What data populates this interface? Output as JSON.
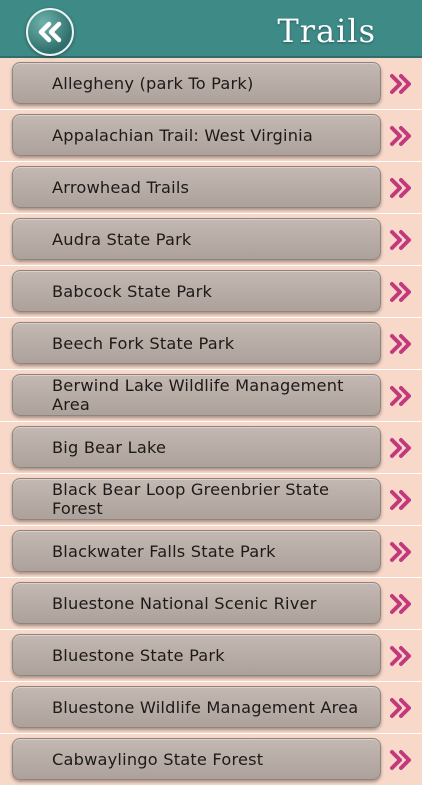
{
  "header": {
    "title": "Trails",
    "back_icon": "double-chevron-left-icon"
  },
  "colors": {
    "header_bg": "#3d8a87",
    "page_bg": "#f8d9c9",
    "item_bg": "#b8ada7",
    "chevron": "#c23a7d"
  },
  "items": [
    {
      "label": "Allegheny (park To Park)"
    },
    {
      "label": "Appalachian Trail: West Virginia"
    },
    {
      "label": "Arrowhead Trails"
    },
    {
      "label": "Audra State Park"
    },
    {
      "label": "Babcock State Park"
    },
    {
      "label": "Beech Fork State Park"
    },
    {
      "label": "Berwind Lake Wildlife Management Area"
    },
    {
      "label": "Big Bear Lake"
    },
    {
      "label": "Black Bear Loop Greenbrier State Forest"
    },
    {
      "label": "Blackwater Falls State Park"
    },
    {
      "label": "Bluestone National Scenic River"
    },
    {
      "label": "Bluestone State Park"
    },
    {
      "label": "Bluestone Wildlife Management Area"
    },
    {
      "label": "Cabwaylingo State Forest"
    }
  ]
}
